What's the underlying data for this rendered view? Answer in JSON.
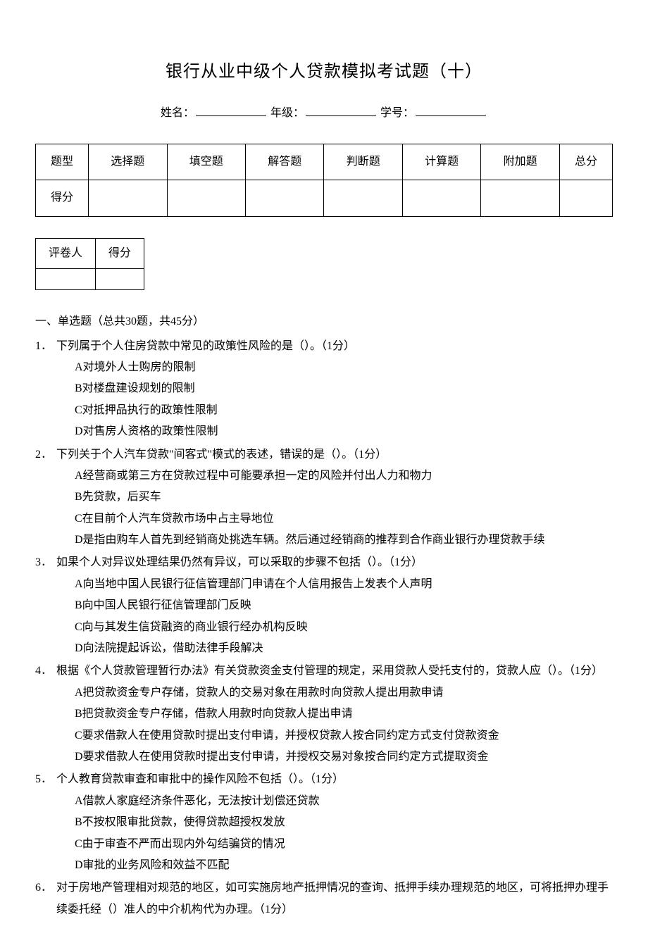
{
  "title": "银行从业中级个人贷款模拟考试题（十）",
  "info": {
    "name_label": "姓名：",
    "grade_label": "年级：",
    "id_label": "学号："
  },
  "score_table": {
    "headers": [
      "题型",
      "选择题",
      "填空题",
      "解答题",
      "判断题",
      "计算题",
      "附加题",
      "总分"
    ],
    "row_label": "得分"
  },
  "grader_table": {
    "col1": "评卷人",
    "col2": "得分"
  },
  "section": "一、单选题（总共30题，共45分）",
  "questions": [
    {
      "num": "1．",
      "text": "下列属于个人住房贷款中常见的政策性风险的是（）。（1分）",
      "options": [
        "A对境外人士购房的限制",
        "B对楼盘建设规划的限制",
        "C对抵押品执行的政策性限制",
        "D对售房人资格的政策性限制"
      ]
    },
    {
      "num": "2．",
      "text": "下列关于个人汽车贷款\"间客式\"模式的表述，错误的是（）。（1分）",
      "options": [
        "A经营商或第三方在贷款过程中可能要承担一定的风险并付出人力和物力",
        "B先贷款，后买车",
        "C在目前个人汽车贷款市场中占主导地位",
        "D是指由购车人首先到经销商处挑选车辆。然后通过经销商的推荐到合作商业银行办理贷款手续"
      ]
    },
    {
      "num": "3．",
      "text": "如果个人对异议处理结果仍然有异议，可以采取的步骤不包括（）。（1分）",
      "options": [
        "A向当地中国人民银行征信管理部门申请在个人信用报告上发表个人声明",
        "B向中国人民银行征信管理部门反映",
        "C向与其发生信贷融资的商业银行经办机构反映",
        "D向法院提起诉讼，借助法律手段解决"
      ]
    },
    {
      "num": "4．",
      "text": "根据《个人贷款管理暂行办法》有关贷款资金支付管理的规定，采用贷款人受托支付的，贷款人应（）。（1分）",
      "options": [
        "A把贷款资金专户存储，贷款人的交易对象在用款时向贷款人提出用款申请",
        "B把贷款资金专户存储，借款人用款时向贷款人提出申请",
        "C要求借款人在使用贷款时提出支付申请，并授权贷款人按合同约定方式支付贷款资金",
        "D要求借款人在使用贷款时提出支付申请，并授权交易对象按合同约定方式提取资金"
      ]
    },
    {
      "num": "5．",
      "text": "个人教育贷款审查和审批中的操作风险不包括（）。（1分）",
      "options": [
        "A借款人家庭经济条件恶化，无法按计划偿还贷款",
        "B不按权限审批贷款，使得贷款超授权发放",
        "C由于审查不严而出现内外勾结骗贷的情况",
        "D审批的业务风险和效益不匹配"
      ]
    },
    {
      "num": "6．",
      "text": "对于房地产管理相对规范的地区，如可实施房地产抵押情况的查询、抵押手续办理规范的地区，可将抵押办理手续委托经（）准人的中介机构代为办理。（1分）",
      "options": []
    }
  ]
}
